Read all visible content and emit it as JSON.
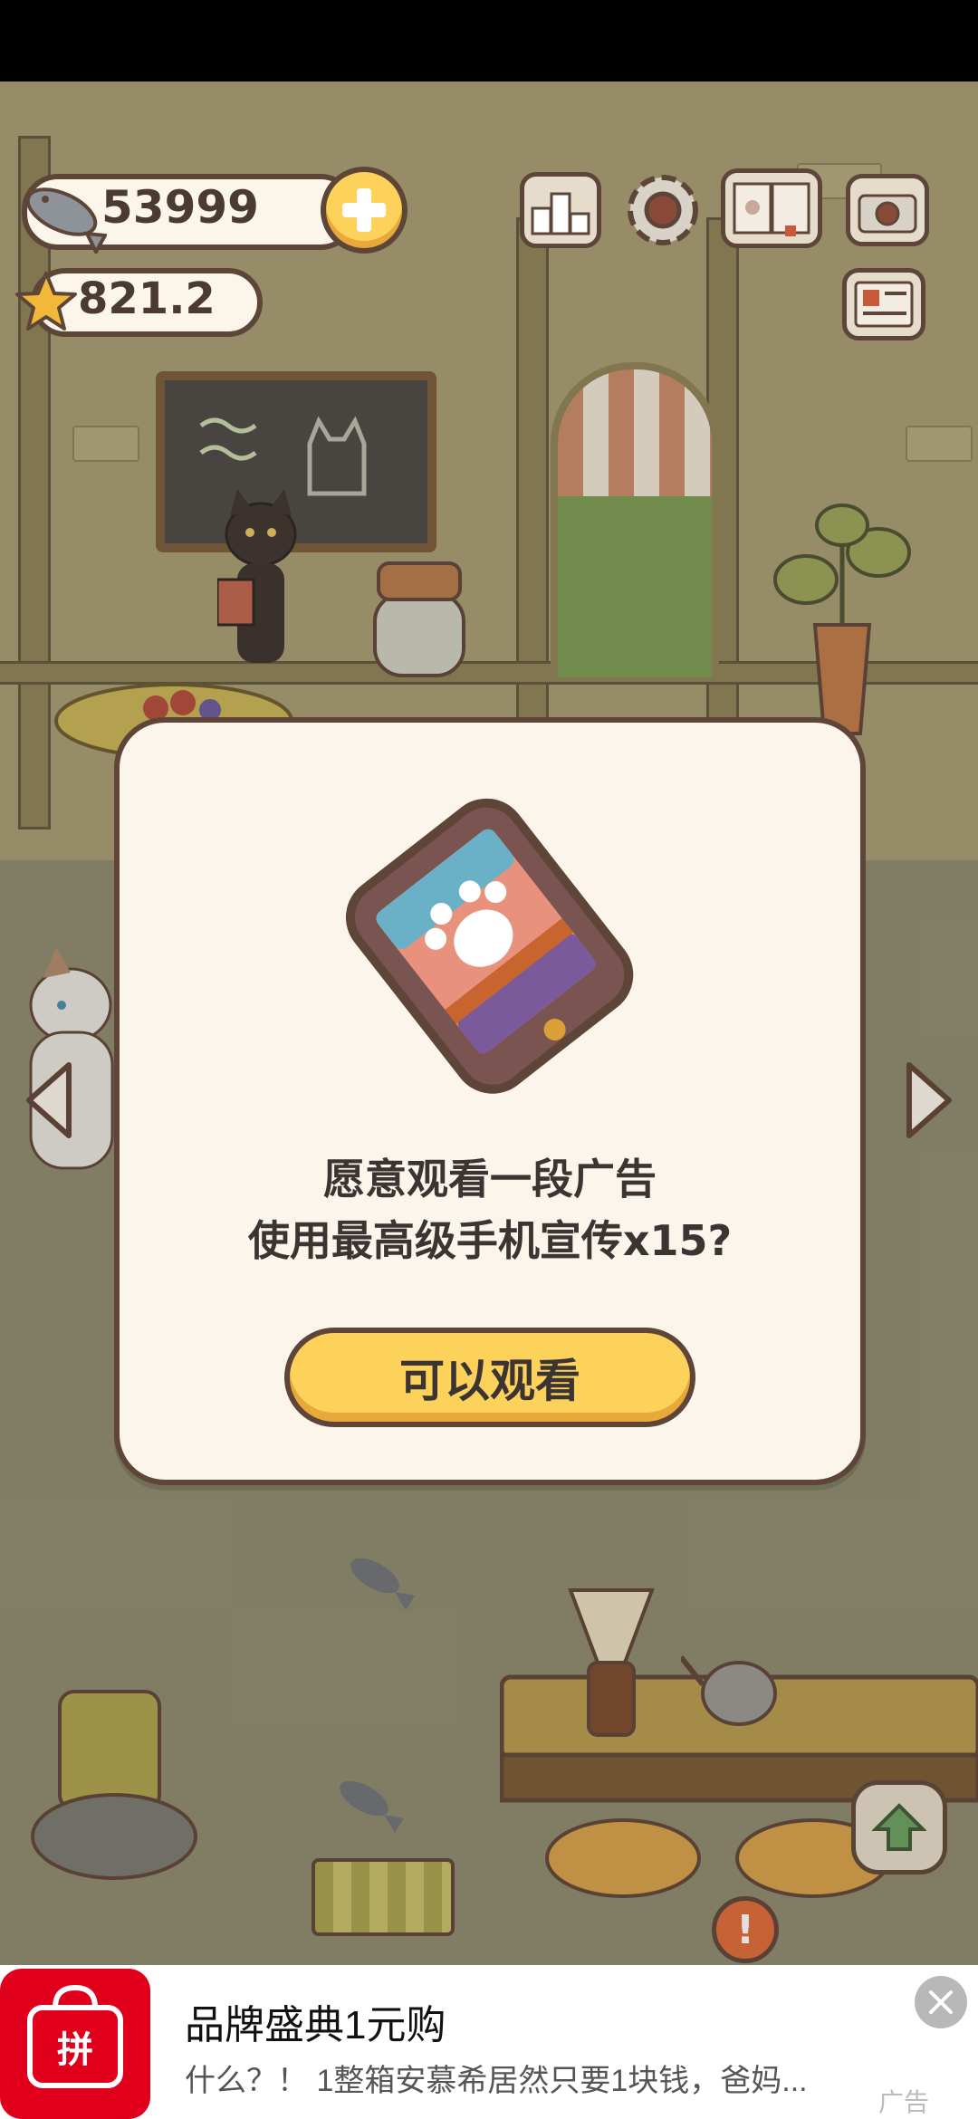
{
  "hud": {
    "fish_count": "53999",
    "star_count": "821.2"
  },
  "dialog": {
    "line1": "愿意观看一段广告",
    "line2": "使用最高级手机宣传x15?",
    "button_label": "可以观看"
  },
  "ad": {
    "title": "品牌盛典1元购",
    "description": "什么？！ 1整箱安慕希居然只要1块钱，爸妈...",
    "tag": "广告",
    "logo_text": "拼"
  },
  "colors": {
    "accent_yellow": "#fcd25a",
    "outline_brown": "#5e4538",
    "dialog_bg": "#fbf5ec",
    "ad_brand_red": "#e0001c"
  },
  "icons": [
    "fish-icon",
    "star-icon",
    "plus-icon",
    "leaderboard-icon",
    "gear-icon",
    "book-icon",
    "camera-icon",
    "newspaper-icon",
    "arrow-left-icon",
    "arrow-right-icon",
    "phone-paw-icon",
    "arrow-up-icon",
    "close-icon"
  ]
}
